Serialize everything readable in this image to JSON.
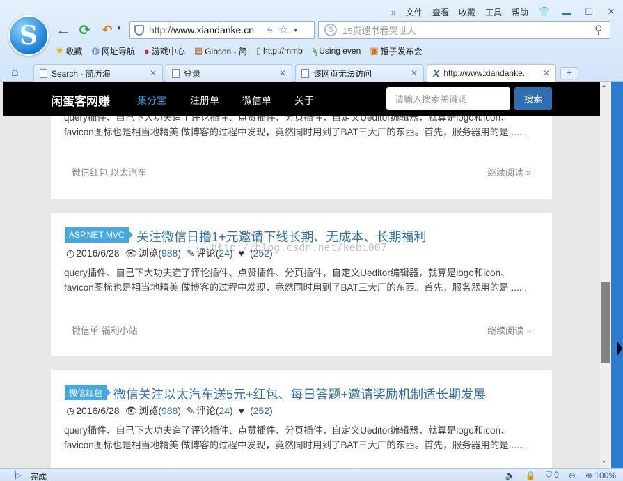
{
  "menu": {
    "items": [
      "文件",
      "查看",
      "收藏",
      "工具",
      "帮助"
    ],
    "more_glyph": "»"
  },
  "toolbar": {
    "address_prefix": "http://",
    "address_host": "www.xiandanke.cn",
    "search_placeholder": "15页遗书看哭世人"
  },
  "favorites": [
    {
      "icon": "star-icon",
      "label": "收藏"
    },
    {
      "icon": "globe-icon",
      "label": "网址导航"
    },
    {
      "icon": "game-icon",
      "label": "游戏中心"
    },
    {
      "icon": "gibson-icon",
      "label": "Gibson - 简"
    },
    {
      "icon": "page-icon",
      "label": "http://mmb"
    },
    {
      "icon": "using-icon",
      "label": "Using even"
    },
    {
      "icon": "hammer-icon",
      "label": "锤子发布会"
    }
  ],
  "tabs": [
    {
      "title": "Search - 简历海",
      "active": false
    },
    {
      "title": "登录",
      "active": false
    },
    {
      "title": "该网页无法访问",
      "active": false
    },
    {
      "title": "http://www.xiandanke.",
      "active": true
    }
  ],
  "site": {
    "brand": "闲蛋客网赚",
    "nav": [
      "集分宝",
      "注册单",
      "微信单",
      "关于"
    ],
    "search_placeholder": "请输入搜索关键词",
    "search_button": "搜索"
  },
  "posts": [
    {
      "excerpt": "query插件、自己下大功夫造了评论插件、点赞插件、分页插件，自定义Ueditor编辑器，就算是logo和icon、favicon图标也是相当地精美 做博客的过程中发现，竟然同时用到了BAT三大厂的东西。首先，服务器用的是.......",
      "tags": "微信红包 以太汽车",
      "read_more": "继续阅读 »"
    },
    {
      "badge": "ASP.NET MVC",
      "title": "关注微信日撸1+元邀请下线长期、无成本、长期福利",
      "date": "2016/6/28",
      "views_label": "浏览",
      "views": "988",
      "comments_label": "评论",
      "comments": "24",
      "likes": "252",
      "excerpt": "query插件、自己下大功夫造了评论插件、点赞插件、分页插件，自定义Ueditor编辑器，就算是logo和icon、favicon图标也是相当地精美 做博客的过程中发现，竟然同时用到了BAT三大厂的东西。首先，服务器用的是.......",
      "tags": "微信单 福利小站",
      "read_more": "继续阅读 »"
    },
    {
      "badge": "微信红包",
      "title": "微信关注以太汽车送5元+红包、每日答题+邀请奖励机制适长期发展",
      "date": "2016/6/28",
      "views_label": "浏览",
      "views": "988",
      "comments_label": "评论",
      "comments": "24",
      "likes": "252",
      "excerpt": "query插件、自己下大功夫造了评论插件、点赞插件、分页插件，自定义Ueditor编辑器，就算是logo和icon、favicon图标也是相当地精美 做博客的过程中发现，竟然同时用到了BAT三大厂的东西。首先，服务器用的是......."
    }
  ],
  "watermark": "http://blog.csdn.net/kebi007",
  "status": {
    "text": "完成",
    "count": "0",
    "zoom": "100%"
  }
}
